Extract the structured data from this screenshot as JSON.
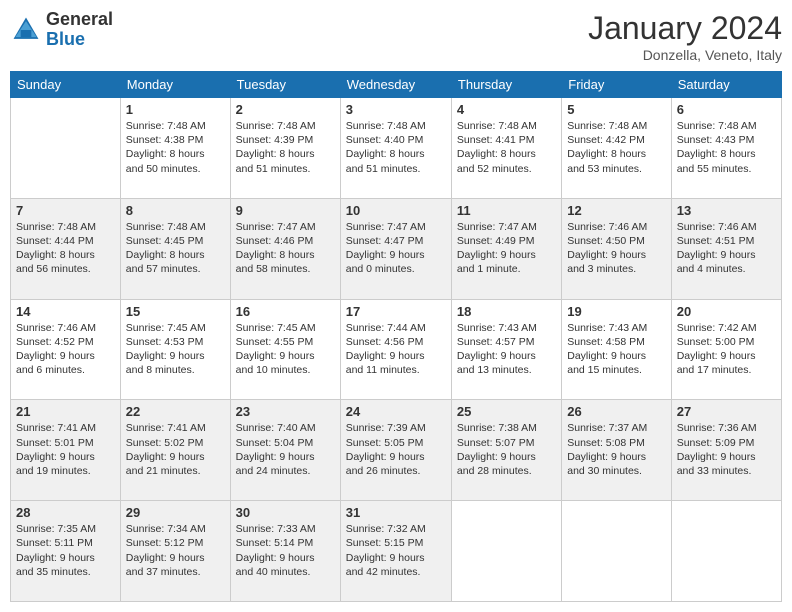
{
  "header": {
    "logo_general": "General",
    "logo_blue": "Blue",
    "month_title": "January 2024",
    "location": "Donzella, Veneto, Italy"
  },
  "days_of_week": [
    "Sunday",
    "Monday",
    "Tuesday",
    "Wednesday",
    "Thursday",
    "Friday",
    "Saturday"
  ],
  "weeks": [
    [
      {
        "day": "",
        "info": ""
      },
      {
        "day": "1",
        "info": "Sunrise: 7:48 AM\nSunset: 4:38 PM\nDaylight: 8 hours\nand 50 minutes."
      },
      {
        "day": "2",
        "info": "Sunrise: 7:48 AM\nSunset: 4:39 PM\nDaylight: 8 hours\nand 51 minutes."
      },
      {
        "day": "3",
        "info": "Sunrise: 7:48 AM\nSunset: 4:40 PM\nDaylight: 8 hours\nand 51 minutes."
      },
      {
        "day": "4",
        "info": "Sunrise: 7:48 AM\nSunset: 4:41 PM\nDaylight: 8 hours\nand 52 minutes."
      },
      {
        "day": "5",
        "info": "Sunrise: 7:48 AM\nSunset: 4:42 PM\nDaylight: 8 hours\nand 53 minutes."
      },
      {
        "day": "6",
        "info": "Sunrise: 7:48 AM\nSunset: 4:43 PM\nDaylight: 8 hours\nand 55 minutes."
      }
    ],
    [
      {
        "day": "7",
        "info": "Sunrise: 7:48 AM\nSunset: 4:44 PM\nDaylight: 8 hours\nand 56 minutes."
      },
      {
        "day": "8",
        "info": "Sunrise: 7:48 AM\nSunset: 4:45 PM\nDaylight: 8 hours\nand 57 minutes."
      },
      {
        "day": "9",
        "info": "Sunrise: 7:47 AM\nSunset: 4:46 PM\nDaylight: 8 hours\nand 58 minutes."
      },
      {
        "day": "10",
        "info": "Sunrise: 7:47 AM\nSunset: 4:47 PM\nDaylight: 9 hours\nand 0 minutes."
      },
      {
        "day": "11",
        "info": "Sunrise: 7:47 AM\nSunset: 4:49 PM\nDaylight: 9 hours\nand 1 minute."
      },
      {
        "day": "12",
        "info": "Sunrise: 7:46 AM\nSunset: 4:50 PM\nDaylight: 9 hours\nand 3 minutes."
      },
      {
        "day": "13",
        "info": "Sunrise: 7:46 AM\nSunset: 4:51 PM\nDaylight: 9 hours\nand 4 minutes."
      }
    ],
    [
      {
        "day": "14",
        "info": "Sunrise: 7:46 AM\nSunset: 4:52 PM\nDaylight: 9 hours\nand 6 minutes."
      },
      {
        "day": "15",
        "info": "Sunrise: 7:45 AM\nSunset: 4:53 PM\nDaylight: 9 hours\nand 8 minutes."
      },
      {
        "day": "16",
        "info": "Sunrise: 7:45 AM\nSunset: 4:55 PM\nDaylight: 9 hours\nand 10 minutes."
      },
      {
        "day": "17",
        "info": "Sunrise: 7:44 AM\nSunset: 4:56 PM\nDaylight: 9 hours\nand 11 minutes."
      },
      {
        "day": "18",
        "info": "Sunrise: 7:43 AM\nSunset: 4:57 PM\nDaylight: 9 hours\nand 13 minutes."
      },
      {
        "day": "19",
        "info": "Sunrise: 7:43 AM\nSunset: 4:58 PM\nDaylight: 9 hours\nand 15 minutes."
      },
      {
        "day": "20",
        "info": "Sunrise: 7:42 AM\nSunset: 5:00 PM\nDaylight: 9 hours\nand 17 minutes."
      }
    ],
    [
      {
        "day": "21",
        "info": "Sunrise: 7:41 AM\nSunset: 5:01 PM\nDaylight: 9 hours\nand 19 minutes."
      },
      {
        "day": "22",
        "info": "Sunrise: 7:41 AM\nSunset: 5:02 PM\nDaylight: 9 hours\nand 21 minutes."
      },
      {
        "day": "23",
        "info": "Sunrise: 7:40 AM\nSunset: 5:04 PM\nDaylight: 9 hours\nand 24 minutes."
      },
      {
        "day": "24",
        "info": "Sunrise: 7:39 AM\nSunset: 5:05 PM\nDaylight: 9 hours\nand 26 minutes."
      },
      {
        "day": "25",
        "info": "Sunrise: 7:38 AM\nSunset: 5:07 PM\nDaylight: 9 hours\nand 28 minutes."
      },
      {
        "day": "26",
        "info": "Sunrise: 7:37 AM\nSunset: 5:08 PM\nDaylight: 9 hours\nand 30 minutes."
      },
      {
        "day": "27",
        "info": "Sunrise: 7:36 AM\nSunset: 5:09 PM\nDaylight: 9 hours\nand 33 minutes."
      }
    ],
    [
      {
        "day": "28",
        "info": "Sunrise: 7:35 AM\nSunset: 5:11 PM\nDaylight: 9 hours\nand 35 minutes."
      },
      {
        "day": "29",
        "info": "Sunrise: 7:34 AM\nSunset: 5:12 PM\nDaylight: 9 hours\nand 37 minutes."
      },
      {
        "day": "30",
        "info": "Sunrise: 7:33 AM\nSunset: 5:14 PM\nDaylight: 9 hours\nand 40 minutes."
      },
      {
        "day": "31",
        "info": "Sunrise: 7:32 AM\nSunset: 5:15 PM\nDaylight: 9 hours\nand 42 minutes."
      },
      {
        "day": "",
        "info": ""
      },
      {
        "day": "",
        "info": ""
      },
      {
        "day": "",
        "info": ""
      }
    ]
  ]
}
